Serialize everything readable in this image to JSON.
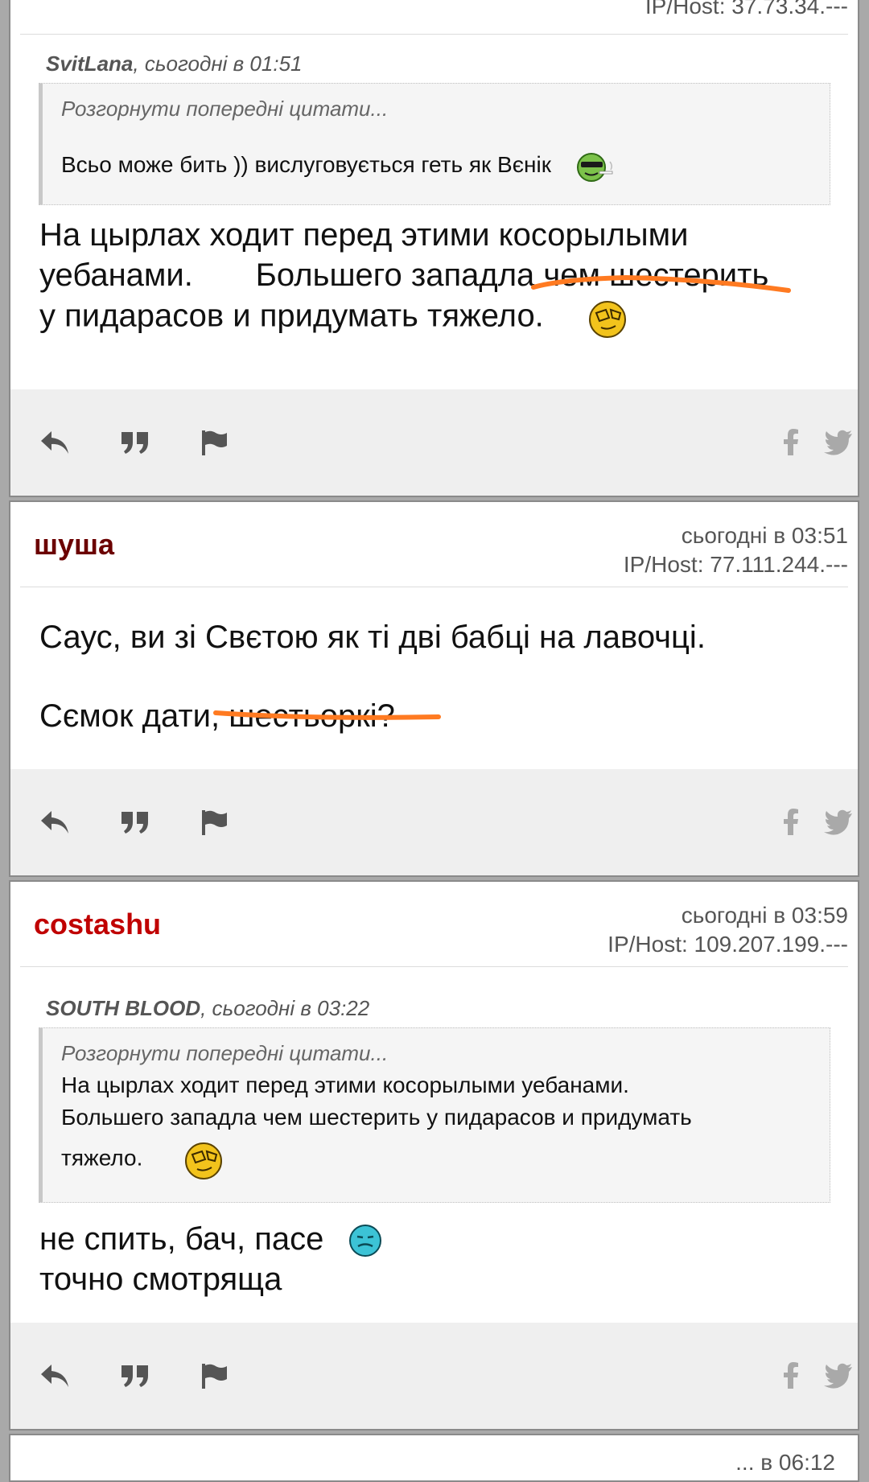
{
  "post_top": {
    "ip_partial": "IP/Host: 37.73.34.---",
    "quote_author": "SvitLana",
    "quote_date": ", сьогодні в 01:51",
    "quote_expand": "Розгорнути попередні цитати...",
    "quote_text": "Всьо може бить )) вислуговується геть як Вєнік",
    "body_line1": "На цырлах ходит перед этими косорылыми",
    "body_line2": "уебанами.       Большего западла чем шестерить",
    "body_line3": "у пидарасов и придумать тяжело."
  },
  "post_shusha": {
    "author": "шуша",
    "author_color": "#6b0000",
    "date": "сьогодні в 03:51",
    "ip": "IP/Host: 77.111.244.---",
    "body_line1": "Саус, ви зі Свєтою як ті дві бабці на лавочці.",
    "body_line2": "Сємок дати, шестьоркі?"
  },
  "post_costashu": {
    "author": "costashu",
    "author_color": "#c00000",
    "date": "сьогодні в 03:59",
    "ip": "IP/Host: 109.207.199.---",
    "quote_author": "SOUTH BLOOD",
    "quote_date": ", сьогодні в 03:22",
    "quote_expand": "Розгорнути попередні цитати...",
    "quote_line1": "На цырлах ходит перед этими косорылыми уебанами.",
    "quote_line2": "Большего западла чем шестерить у пидарасов и придумать",
    "quote_line3": "тяжело.",
    "body_line1": "не спить, бач, пасе",
    "body_line2": "точно смотряща"
  },
  "post_bottom": {
    "partial_date": "... в 06:12"
  },
  "toolbar_icons": [
    "reply-icon",
    "quote-icon",
    "flag-icon",
    "facebook-icon",
    "twitter-icon"
  ],
  "colors": {
    "underline": "#ff7a21",
    "toolbar_bg": "#efefef",
    "icon": "#555555",
    "share_icon": "#a9a9a9"
  }
}
